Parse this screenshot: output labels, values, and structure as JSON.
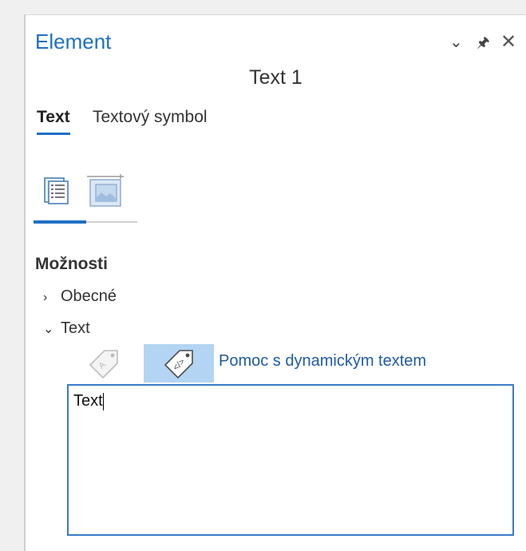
{
  "pane": {
    "title": "Element",
    "actions": {
      "options_icon": "chevron-down-icon",
      "pin_icon": "pin-icon",
      "close_icon": "close-icon"
    }
  },
  "element_name": "Text 1",
  "tabs": [
    {
      "label": "Text",
      "active": true
    },
    {
      "label": "Textový symbol",
      "active": false
    }
  ],
  "icon_tabs": [
    {
      "icon": "text-options-icon",
      "active": true
    },
    {
      "icon": "display-options-icon",
      "active": false
    }
  ],
  "section": {
    "label": "Možnosti"
  },
  "groups": [
    {
      "label": "Obecné",
      "expanded": false
    },
    {
      "label": "Text",
      "expanded": true
    }
  ],
  "insert": {
    "static_tag_icon": "text-tag-icon",
    "dynamic_tag_icon": "dynamic-text-tag-icon",
    "dynamic_help_label": "Pomoc s dynamickým textem"
  },
  "text_box": {
    "value": "Text"
  },
  "colors": {
    "accent": "#1f6fc5",
    "selected_button": "#b3d4f2",
    "link": "#1f5aa6"
  }
}
